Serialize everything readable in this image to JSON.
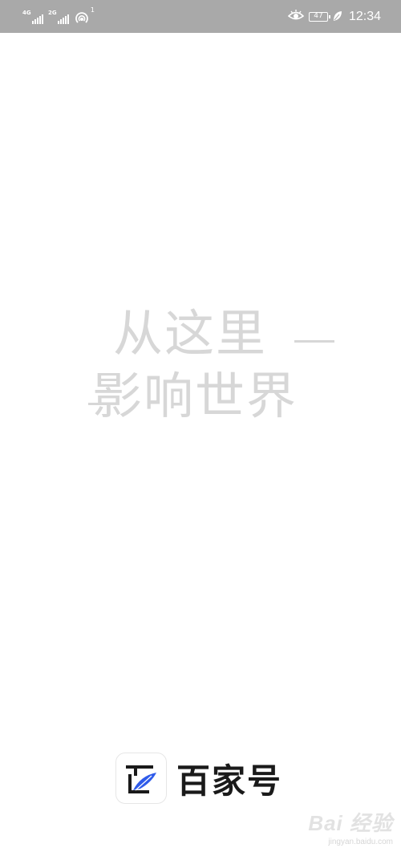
{
  "status_bar": {
    "sim1_network": "4G",
    "sim2_network": "2G",
    "hotspot_count": "1",
    "battery_level": "47",
    "time": "12:34",
    "icons": [
      "signal-icon",
      "signal-icon",
      "hotspot-icon",
      "eye-icon",
      "battery-icon",
      "leaf-icon"
    ]
  },
  "splash": {
    "slogan_line1": "从这里",
    "slogan_line2": "影响世界"
  },
  "brand": {
    "name": "百家号",
    "icon": "baijiahao-logo-icon",
    "accent_color": "#2f5bea"
  },
  "watermark": {
    "text": "Bai 经验",
    "url": "jingyan.baidu.com"
  }
}
